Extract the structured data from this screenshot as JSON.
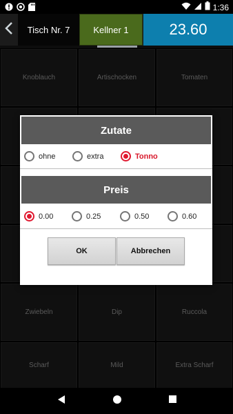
{
  "status_bar": {
    "time": "1:36"
  },
  "header": {
    "table": "Tisch Nr. 7",
    "waiter": "Kellner 1",
    "total": "23.60"
  },
  "grid": {
    "rows": [
      [
        "Knoblauch",
        "Artischocken",
        "Tomaten"
      ],
      [
        "",
        "",
        ""
      ],
      [
        "",
        "",
        ""
      ],
      [
        "",
        "",
        ""
      ],
      [
        "Zwiebeln",
        "Dip",
        "Ruccola"
      ],
      [
        "Scharf",
        "Mild",
        "Extra Scharf"
      ]
    ]
  },
  "dialog": {
    "ingredient_title": "Zutate",
    "ingredient_options": [
      "ohne",
      "extra",
      "Tonno"
    ],
    "ingredient_selected": "Tonno",
    "price_title": "Preis",
    "price_options": [
      "0.00",
      "0.25",
      "0.50",
      "0.60"
    ],
    "price_selected": "0.00",
    "ok_label": "OK",
    "cancel_label": "Abbrechen"
  },
  "colors": {
    "waiter_bg": "#4a6a1c",
    "total_bg": "#0d7fae",
    "radio_accent": "#e0182f",
    "section_header_bg": "#5a5a5a"
  }
}
